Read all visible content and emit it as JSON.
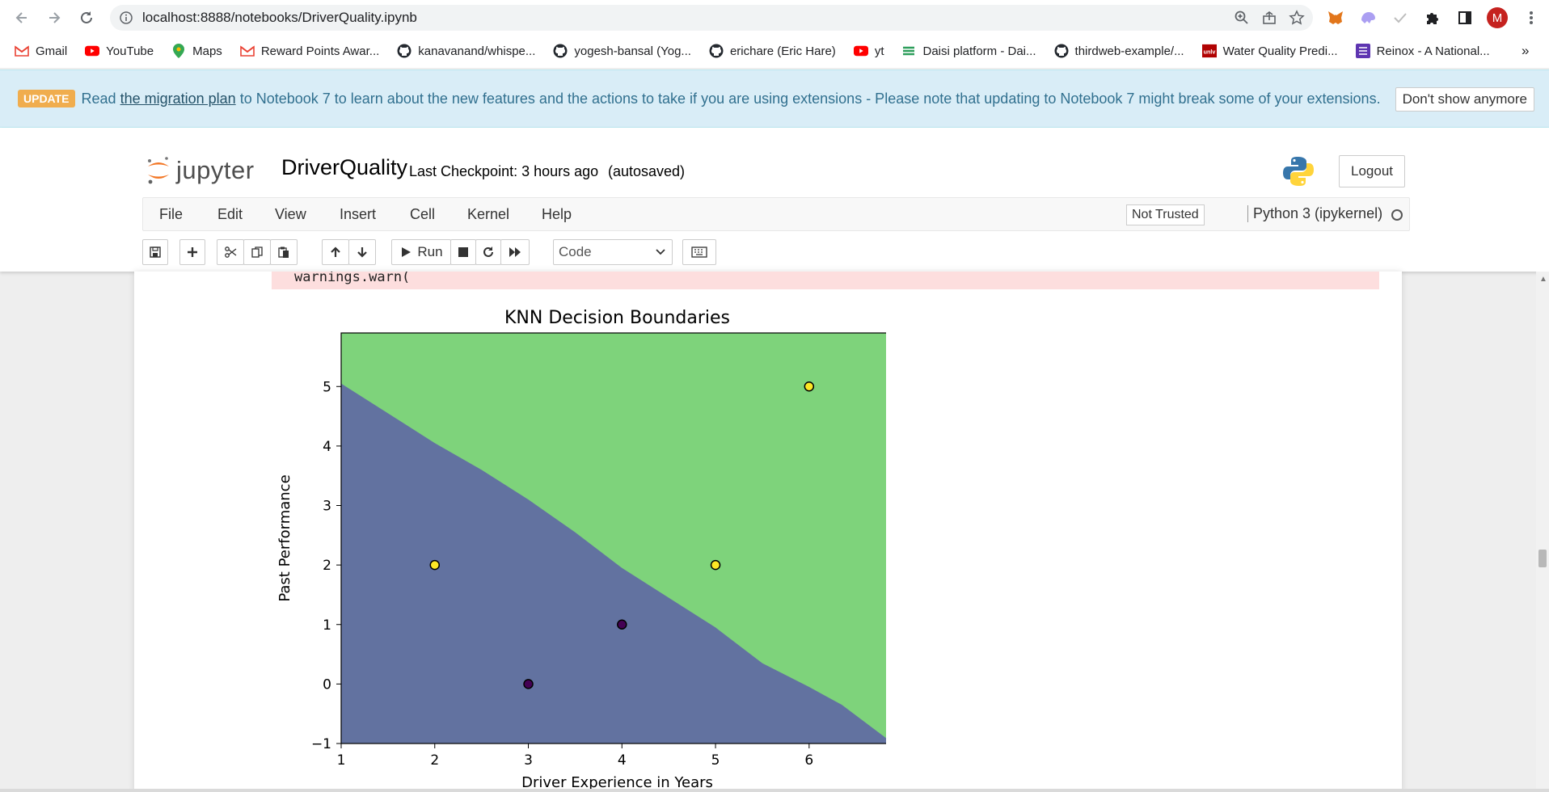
{
  "browser": {
    "url": "localhost:8888/notebooks/DriverQuality.ipynb",
    "profile_initial": "M",
    "bookmarks": [
      {
        "label": "Gmail",
        "icon": "gmail-icon"
      },
      {
        "label": "YouTube",
        "icon": "youtube-icon"
      },
      {
        "label": "Maps",
        "icon": "maps-icon"
      },
      {
        "label": "Reward Points Awar...",
        "icon": "gmail-icon"
      },
      {
        "label": "kanavanand/whispe...",
        "icon": "github-icon"
      },
      {
        "label": "yogesh-bansal (Yog...",
        "icon": "github-icon"
      },
      {
        "label": "erichare (Eric Hare)",
        "icon": "github-icon"
      },
      {
        "label": "yt",
        "icon": "youtube-icon"
      },
      {
        "label": "Daisi platform - Dai...",
        "icon": "daisi-icon"
      },
      {
        "label": "thirdweb-example/...",
        "icon": "github-icon"
      },
      {
        "label": "Water Quality Predi...",
        "icon": "unlv-icon"
      },
      {
        "label": "Reinox - A National...",
        "icon": "list-icon"
      }
    ],
    "more_bookmarks": "»"
  },
  "banner": {
    "badge": "UPDATE",
    "text_before": "Read",
    "link": "the migration plan",
    "text_after": "to Notebook 7 to learn about the new features and the actions to take if you are using extensions - Please note that updating to Notebook 7 might break some of your extensions.",
    "dismiss": "Don't show anymore"
  },
  "jupyter": {
    "logo_text": "jupyter",
    "notebook_name": "DriverQuality",
    "checkpoint": "Last Checkpoint: 3 hours ago",
    "autosave": "(autosaved)",
    "logout": "Logout",
    "menu": [
      "File",
      "Edit",
      "View",
      "Insert",
      "Cell",
      "Kernel",
      "Help"
    ],
    "trust": "Not Trusted",
    "kernel": "Python 3 (ipykernel)",
    "run_label": "Run",
    "cell_type": "Code"
  },
  "output": {
    "stderr_line": "warnings.warn("
  },
  "colors": {
    "class0_region": "#6272a0",
    "class1_region": "#7ed37b",
    "class0_point": "#440154",
    "class1_point": "#fde725"
  },
  "chart_data": {
    "type": "scatter",
    "title": "KNN Decision Boundaries",
    "xlabel": "Driver Experience in Years",
    "ylabel": "Past Performance",
    "xlim": [
      1,
      6.9
    ],
    "ylim": [
      -1,
      5.9
    ],
    "xticks": [
      1,
      2,
      3,
      4,
      5,
      6
    ],
    "yticks": [
      -1,
      0,
      1,
      2,
      3,
      4,
      5
    ],
    "ytick_labels": [
      "−1",
      "0",
      "1",
      "2",
      "3",
      "4",
      "5"
    ],
    "points": [
      {
        "x": 2,
        "y": 2,
        "class": 1
      },
      {
        "x": 3,
        "y": 0,
        "class": 0
      },
      {
        "x": 4,
        "y": 1,
        "class": 0
      },
      {
        "x": 5,
        "y": 2,
        "class": 1
      },
      {
        "x": 6,
        "y": 5,
        "class": 1
      }
    ],
    "boundary": [
      {
        "x": 1,
        "y": 5.05
      },
      {
        "x": 1.25,
        "y": 4.8
      },
      {
        "x": 2.0,
        "y": 4.05
      },
      {
        "x": 2.5,
        "y": 3.6
      },
      {
        "x": 3.0,
        "y": 3.1
      },
      {
        "x": 3.5,
        "y": 2.55
      },
      {
        "x": 4.0,
        "y": 1.95
      },
      {
        "x": 4.5,
        "y": 1.45
      },
      {
        "x": 5.0,
        "y": 0.95
      },
      {
        "x": 5.5,
        "y": 0.35
      },
      {
        "x": 6.0,
        "y": -0.05
      },
      {
        "x": 6.35,
        "y": -0.35
      },
      {
        "x": 6.9,
        "y": -1.0
      }
    ],
    "grid": false,
    "legend": "none"
  }
}
